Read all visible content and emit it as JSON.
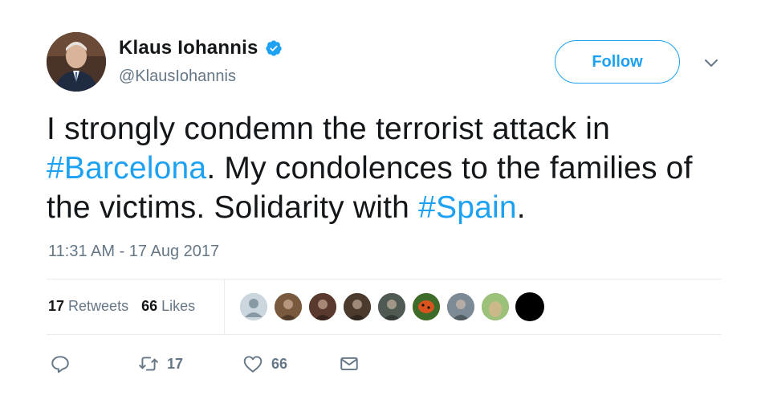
{
  "author": {
    "name": "Klaus Iohannis",
    "handle": "@KlausIohannis",
    "verified": true
  },
  "follow_label": "Follow",
  "tweet": {
    "parts": [
      {
        "text": "I strongly condemn the terrorist attack in ",
        "type": "text"
      },
      {
        "text": "#Barcelona",
        "type": "hashtag"
      },
      {
        "text": ". My condolences to the families of the victims. Solidarity with ",
        "type": "text"
      },
      {
        "text": "#Spain",
        "type": "hashtag"
      },
      {
        "text": ".",
        "type": "text"
      }
    ]
  },
  "timestamp": "11:31 AM - 17 Aug 2017",
  "stats": {
    "retweets_count": "17",
    "retweets_label": "Retweets",
    "likes_count": "66",
    "likes_label": "Likes"
  },
  "actions": {
    "reply_count": "",
    "retweet_count": "17",
    "like_count": "66"
  },
  "colors": {
    "accent": "#1da1f2",
    "muted": "#657786",
    "text": "#14171a",
    "border": "#e6ecf0"
  },
  "liker_avatars": [
    {
      "name": "default-avatar",
      "color": "#aab8c2"
    },
    {
      "name": "avatar-2",
      "color": "#7a5a3e"
    },
    {
      "name": "avatar-3",
      "color": "#5a3a2e"
    },
    {
      "name": "avatar-4",
      "color": "#4a3b2e"
    },
    {
      "name": "avatar-5",
      "color": "#4e5a52"
    },
    {
      "name": "avatar-6",
      "color": "#c0521e"
    },
    {
      "name": "avatar-7",
      "color": "#7c8a96"
    },
    {
      "name": "avatar-8",
      "color": "#8bae6a"
    },
    {
      "name": "avatar-9",
      "color": "#000000"
    }
  ]
}
